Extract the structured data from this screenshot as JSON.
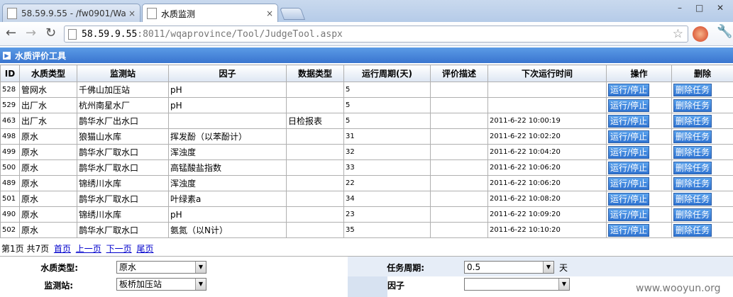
{
  "browser": {
    "tabs": [
      {
        "title": "58.59.9.55 - /fw0901/Wa"
      },
      {
        "title": "水质监测"
      }
    ],
    "tab_close": "×",
    "window_controls": {
      "minimize": "–",
      "maximize": "□",
      "close": "✕"
    },
    "url_host": "58.59.9.55",
    "url_rest": ":8011/wqaprovince/Tool/JudgeTool.aspx",
    "icons": {
      "back": "←",
      "forward": "→",
      "reload": "↻",
      "star": "☆",
      "wrench": "🔧"
    }
  },
  "panel": {
    "title": "水质评价工具"
  },
  "table": {
    "headers": [
      "ID",
      "水质类型",
      "监测站",
      "因子",
      "数据类型",
      "运行周期(天)",
      "评价描述",
      "下次运行时间",
      "操作",
      "删除"
    ],
    "run_label": "运行/停止",
    "delete_label": "删除任务",
    "rows": [
      {
        "id": "528",
        "type": "管网水",
        "station": "千佛山加压站",
        "factor": "pH",
        "dtype": "",
        "period": "5",
        "desc": "",
        "next": ""
      },
      {
        "id": "529",
        "type": "出厂水",
        "station": "杭州南星水厂",
        "factor": "pH",
        "dtype": "",
        "period": "5",
        "desc": "",
        "next": ""
      },
      {
        "id": "463",
        "type": "出厂水",
        "station": "鹊华水厂出水口",
        "factor": "",
        "dtype": "日检报表",
        "period": "5",
        "desc": "",
        "next": "2011-6-22 10:00:19"
      },
      {
        "id": "498",
        "type": "原水",
        "station": "狼猫山水库",
        "factor": "挥发酚（以苯酚计）",
        "dtype": "",
        "period": "31",
        "desc": "",
        "next": "2011-6-22 10:02:20"
      },
      {
        "id": "499",
        "type": "原水",
        "station": "鹊华水厂取水口",
        "factor": "浑浊度",
        "dtype": "",
        "period": "32",
        "desc": "",
        "next": "2011-6-22 10:04:20"
      },
      {
        "id": "500",
        "type": "原水",
        "station": "鹊华水厂取水口",
        "factor": "高锰酸盐指数",
        "dtype": "",
        "period": "33",
        "desc": "",
        "next": "2011-6-22 10:06:20"
      },
      {
        "id": "489",
        "type": "原水",
        "station": "锦绣川水库",
        "factor": "浑浊度",
        "dtype": "",
        "period": "22",
        "desc": "",
        "next": "2011-6-22 10:06:20"
      },
      {
        "id": "501",
        "type": "原水",
        "station": "鹊华水厂取水口",
        "factor": "叶绿素a",
        "dtype": "",
        "period": "34",
        "desc": "",
        "next": "2011-6-22 10:08:20"
      },
      {
        "id": "490",
        "type": "原水",
        "station": "锦绣川水库",
        "factor": "pH",
        "dtype": "",
        "period": "23",
        "desc": "",
        "next": "2011-6-22 10:09:20"
      },
      {
        "id": "502",
        "type": "原水",
        "station": "鹊华水厂取水口",
        "factor": "氨氮（以N计）",
        "dtype": "",
        "period": "35",
        "desc": "",
        "next": "2011-6-22 10:10:20"
      }
    ]
  },
  "pager": {
    "info": "第1页 共7页",
    "first": "首页",
    "prev": "上一页",
    "next": "下一页",
    "last": "尾页"
  },
  "form": {
    "water_type_label": "水质类型:",
    "water_type_value": "原水",
    "station_label": "监测站:",
    "station_value": "板桥加压站",
    "period_label": "任务周期:",
    "period_value": "0.5",
    "period_unit": "天",
    "factor_label": "因子",
    "factor_value": "",
    "dropdown_glyph": "▼"
  },
  "watermark": "www.wooyun.org"
}
